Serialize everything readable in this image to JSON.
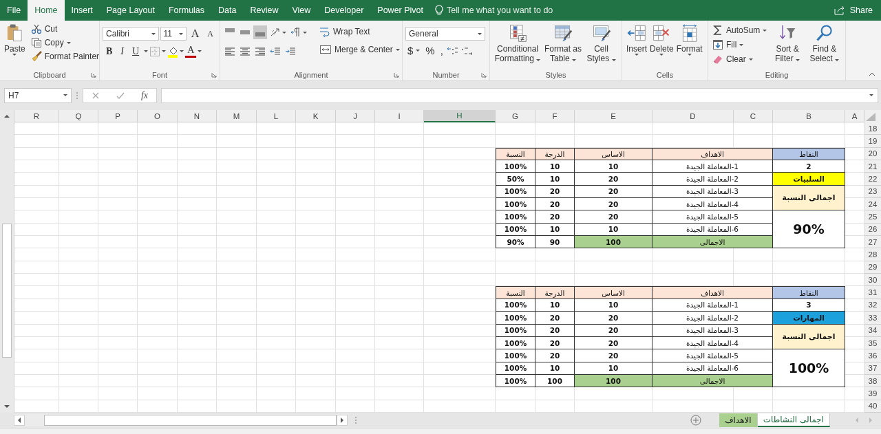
{
  "ribbon_tabs": {
    "file": {
      "label": "File",
      "selected": false
    },
    "home": {
      "label": "Home",
      "selected": true
    },
    "insert": {
      "label": "Insert",
      "selected": false
    },
    "page_layout": {
      "label": "Page Layout",
      "selected": false
    },
    "formulas": {
      "label": "Formulas",
      "selected": false
    },
    "data": {
      "label": "Data",
      "selected": false
    },
    "review": {
      "label": "Review",
      "selected": false
    },
    "view": {
      "label": "View",
      "selected": false
    },
    "developer": {
      "label": "Developer",
      "selected": false
    },
    "power_pivot": {
      "label": "Power Pivot",
      "selected": false
    }
  },
  "tell_me": "Tell me what you want to do",
  "share": "Share",
  "ribbon": {
    "clipboard": {
      "label": "Clipboard",
      "paste": "Paste",
      "small": [
        {
          "label": "Cut",
          "dropdown": false
        },
        {
          "label": "Copy",
          "dropdown": true
        },
        {
          "label": "Format Painter",
          "dropdown": false
        }
      ]
    },
    "font": {
      "label": "Font",
      "name": "Calibri",
      "size": "11",
      "grow": "A",
      "shrink": "A",
      "bold": "B",
      "italic": "I",
      "underline": "U",
      "color_button": "A"
    },
    "alignment": {
      "label": "Alignment",
      "vertical": [
        {
          "selected": false
        },
        {
          "selected": false
        },
        {
          "selected": true
        }
      ],
      "wrap": "Wrap Text",
      "merge": "Merge & Center"
    },
    "number": {
      "label": "Number",
      "format": "General",
      "currency": {
        "label": "$",
        "dropdown": true
      },
      "percent": {
        "label": "%",
        "dropdown": false
      },
      "comma": {
        "label": ",",
        "dropdown": false
      }
    },
    "styles": {
      "label": "Styles",
      "conditional_formatting": "Conditional Formatting",
      "format_as_table": "Format as Table",
      "cell_styles": "Cell Styles"
    },
    "cells": {
      "label": "Cells",
      "insert": "Insert",
      "delete": "Delete",
      "format": "Format"
    },
    "editing": {
      "label": "Editing",
      "small": [
        "AutoSum",
        "Fill",
        "Clear"
      ],
      "sort_filter": "Sort & Filter",
      "find_select": "Find & Select"
    }
  },
  "formula_bar": {
    "name_box": "H7",
    "function_label": "fx"
  },
  "sheet": {
    "columns": [
      {
        "label": "A",
        "selected": false
      },
      {
        "label": "B",
        "selected": false
      },
      {
        "label": "C",
        "selected": false
      },
      {
        "label": "D",
        "selected": false
      },
      {
        "label": "E",
        "selected": false
      },
      {
        "label": "F",
        "selected": false
      },
      {
        "label": "G",
        "selected": false
      },
      {
        "label": "H",
        "selected": true
      },
      {
        "label": "I",
        "selected": false
      },
      {
        "label": "J",
        "selected": false
      },
      {
        "label": "K",
        "selected": false
      },
      {
        "label": "L",
        "selected": false
      },
      {
        "label": "M",
        "selected": false
      },
      {
        "label": "N",
        "selected": false
      },
      {
        "label": "O",
        "selected": false
      },
      {
        "label": "P",
        "selected": false
      },
      {
        "label": "Q",
        "selected": false
      },
      {
        "label": "R",
        "selected": false
      }
    ],
    "rows": [
      "18",
      "19",
      "20",
      "21",
      "22",
      "23",
      "24",
      "25",
      "26",
      "27",
      "28",
      "29",
      "30",
      "31",
      "32",
      "33",
      "34",
      "35",
      "36",
      "37",
      "38",
      "39",
      "40"
    ],
    "tables": [
      {
        "header": {
          "points": "النقاط",
          "goals": "الاهداف",
          "base": "الاساس",
          "grade": "الدرجة",
          "ratio": "النسبة"
        },
        "points_value": "2",
        "category": {
          "label": "السلبيات",
          "color": "#ffff00"
        },
        "total_ratio_label": "اجمالى النسبة",
        "total_ratio": "90%",
        "rows": [
          {
            "goal": "1-المعاملة الجيدة",
            "base": "10",
            "grade": "10",
            "ratio": "100%"
          },
          {
            "goal": "2-المعاملة الجيدة",
            "base": "20",
            "grade": "10",
            "ratio": "50%"
          },
          {
            "goal": "3-المعاملة الجيدة",
            "base": "20",
            "grade": "20",
            "ratio": "100%"
          },
          {
            "goal": "4-المعاملة الجيدة",
            "base": "20",
            "grade": "20",
            "ratio": "100%"
          },
          {
            "goal": "5-المعاملة الجيدة",
            "base": "20",
            "grade": "20",
            "ratio": "100%"
          },
          {
            "goal": "6-المعاملة الجيدة",
            "base": "10",
            "grade": "10",
            "ratio": "100%"
          }
        ],
        "total": {
          "label": "الاجمالى",
          "base": "100",
          "grade": "90",
          "ratio": "90%"
        }
      },
      {
        "header": {
          "points": "النقاط",
          "goals": "الاهداف",
          "base": "الاساس",
          "grade": "الدرجة",
          "ratio": "النسبة"
        },
        "points_value": "3",
        "category": {
          "label": "المهارات",
          "color": "#1da1dc"
        },
        "total_ratio_label": "اجمالى النسبة",
        "total_ratio": "100%",
        "rows": [
          {
            "goal": "1-المعاملة الجيدة",
            "base": "10",
            "grade": "10",
            "ratio": "100%"
          },
          {
            "goal": "2-المعاملة الجيدة",
            "base": "20",
            "grade": "20",
            "ratio": "100%"
          },
          {
            "goal": "3-المعاملة الجيدة",
            "base": "20",
            "grade": "20",
            "ratio": "100%"
          },
          {
            "goal": "4-المعاملة الجيدة",
            "base": "20",
            "grade": "20",
            "ratio": "100%"
          },
          {
            "goal": "5-المعاملة الجيدة",
            "base": "20",
            "grade": "20",
            "ratio": "100%"
          },
          {
            "goal": "6-المعاملة الجيدة",
            "base": "10",
            "grade": "10",
            "ratio": "100%"
          }
        ],
        "total": {
          "label": "الاجمالى",
          "base": "100",
          "grade": "100",
          "ratio": "100%"
        }
      }
    ]
  },
  "sheet_tabs": [
    {
      "label": "اجمالى النشاطات",
      "selected": true
    },
    {
      "label": "الاهداف",
      "selected": false,
      "color": "#a9d08e"
    }
  ]
}
